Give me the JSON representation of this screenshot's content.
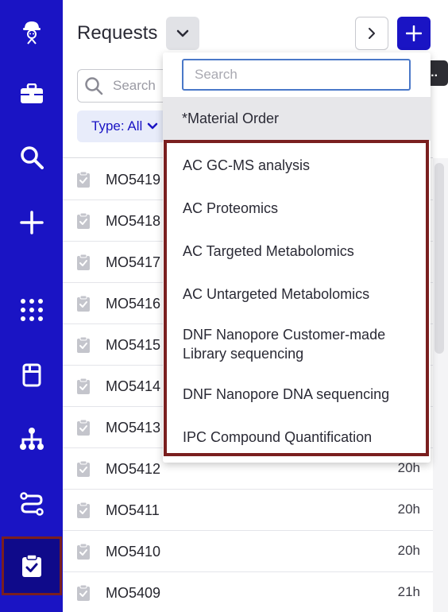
{
  "header": {
    "title": "Requests",
    "tooltip": "Create..."
  },
  "background": {
    "search_placeholder": "Search",
    "type_filter": "Type: All"
  },
  "dropdown": {
    "search_placeholder": "Search",
    "default_item": "*Material Order",
    "items": [
      "AC GC-MS analysis",
      "AC Proteomics",
      "AC Targeted Metabolomics",
      "AC Untargeted Metabolomics",
      "DNF Nanopore Customer-made Library sequencing",
      "DNF Nanopore DNA sequencing",
      "IPC Compound Quantification"
    ]
  },
  "rows": [
    {
      "id": "MO5419",
      "time": ""
    },
    {
      "id": "MO5418",
      "time": ""
    },
    {
      "id": "MO5417",
      "time": ""
    },
    {
      "id": "MO5416",
      "time": ""
    },
    {
      "id": "MO5415",
      "time": ""
    },
    {
      "id": "MO5414",
      "time": ""
    },
    {
      "id": "MO5413",
      "time": ""
    },
    {
      "id": "MO5412",
      "time": "20h"
    },
    {
      "id": "MO5411",
      "time": "20h"
    },
    {
      "id": "MO5410",
      "time": "20h"
    },
    {
      "id": "MO5409",
      "time": "21h"
    }
  ],
  "icons": {
    "sidebar": [
      "mascot-icon",
      "briefcase-icon",
      "search-icon",
      "plus-icon",
      "apps-grid-icon",
      "notebook-icon",
      "hierarchy-icon",
      "workflow-icon",
      "clipboard-check-icon"
    ]
  },
  "colors": {
    "sidebar": "#1a14c4",
    "active_nav": "#0f0a8a",
    "highlight_border": "#7a1f1f",
    "tooltip_bg": "#2d2d33",
    "filter_bg": "#e8ecfa"
  }
}
